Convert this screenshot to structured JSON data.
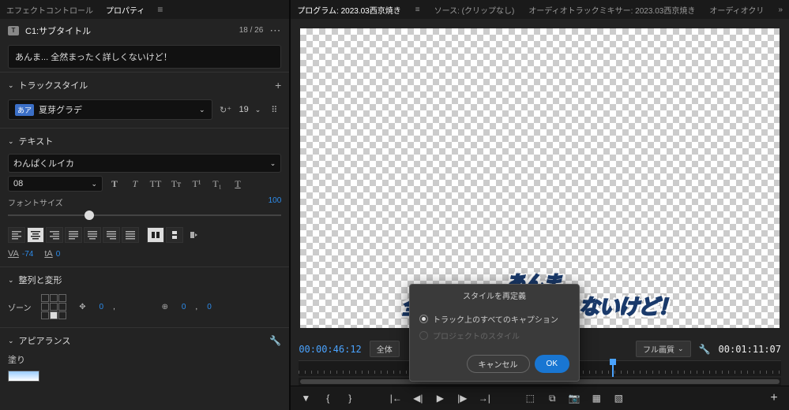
{
  "left_tabs": {
    "effect": "エフェクトコントロール",
    "properties": "プロパティ"
  },
  "caption": {
    "track_label": "C1:サブタイトル",
    "counter": "18 / 26",
    "text": "あんま... 全然まったく詳しくないけど！"
  },
  "track_style": {
    "header": "トラックスタイル",
    "preset_badge": "あア",
    "preset_name": "夏芽グラデ",
    "count": "19"
  },
  "text_section": {
    "header": "テキスト",
    "font_name": "わんぱくルイカ",
    "font_weight": "08",
    "styles": {
      "bold": "T",
      "italic": "T",
      "allcaps": "TT",
      "smallcaps": "Tᴛ",
      "super": "T¹",
      "sub": "T₁",
      "underline": "T"
    },
    "font_size_label": "フォントサイズ",
    "font_size_value": "100",
    "kerning": {
      "va_label": "VA",
      "va_value": "-74",
      "leading_label": "tA",
      "leading_value": "0"
    }
  },
  "align_section": {
    "header": "整列と変形",
    "zone_label": "ゾーン",
    "pos_x": "0",
    "pos_y": "",
    "scale_x": "0",
    "scale_y": "0"
  },
  "appearance": {
    "header": "アピアランス",
    "fill_label": "塗り"
  },
  "right_tabs": {
    "program_label": "プログラム:",
    "program_name": "2023.03西京焼き",
    "source_label": "ソース:",
    "source_name": "(クリップなし)",
    "mixer_label": "オーディオトラックミキサー:",
    "mixer_name": "2023.03西京焼き",
    "audio_clip": "オーディオクリ"
  },
  "subtitle_preview": {
    "line1": "あんま...",
    "line2": "全然まったく詳しくないけど！"
  },
  "timebar": {
    "current": "00:00:46:12",
    "fit": "全体",
    "quality": "フル画質",
    "duration": "00:01:11:07"
  },
  "dialog": {
    "title": "スタイルを再定義",
    "option1": "トラック上のすべてのキャプション",
    "option2": "プロジェクトのスタイル",
    "cancel": "キャンセル",
    "ok": "OK"
  }
}
